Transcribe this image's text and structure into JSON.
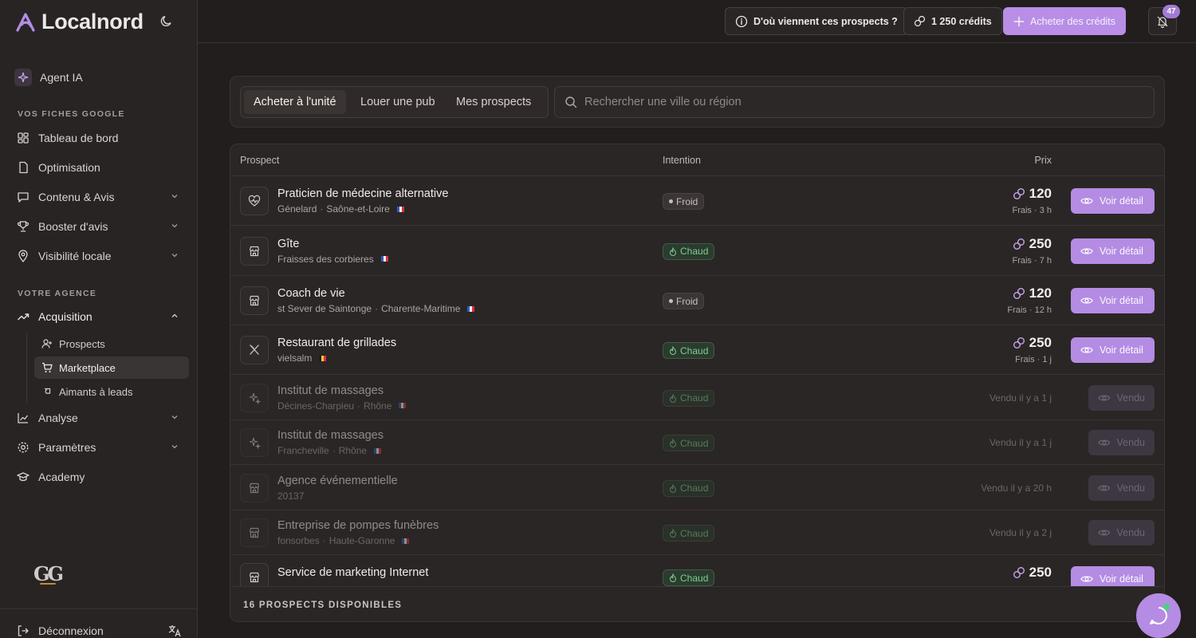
{
  "app": {
    "logo_text": "Localnord"
  },
  "header": {
    "info_label": "D'où viennent ces prospects ?",
    "credits_label": "1 250 crédits",
    "buy_label": "Acheter des crédits",
    "notification_count": "47"
  },
  "sidebar": {
    "agent_label": "Agent IA",
    "section_google": "VOS FICHES GOOGLE",
    "items_google": [
      {
        "label": "Tableau de bord",
        "icon": "dashboard-icon"
      },
      {
        "label": "Optimisation",
        "icon": "document-icon"
      },
      {
        "label": "Contenu & Avis",
        "icon": "message-icon"
      },
      {
        "label": "Booster d'avis",
        "icon": "trophy-icon"
      },
      {
        "label": "Visibilité locale",
        "icon": "map-pin-icon"
      }
    ],
    "section_agency": "VOTRE AGENCE",
    "acquisition_label": "Acquisition",
    "sub_items": [
      {
        "label": "Prospects"
      },
      {
        "label": "Marketplace"
      },
      {
        "label": "Aimants à leads"
      }
    ],
    "items_agency": [
      {
        "label": "Analyse"
      },
      {
        "label": "Paramètres"
      },
      {
        "label": "Academy"
      }
    ],
    "brand_mark": "GG",
    "logout_label": "Déconnexion"
  },
  "tabs": [
    {
      "label": "Acheter à l'unité"
    },
    {
      "label": "Louer une pub"
    },
    {
      "label": "Mes prospects"
    }
  ],
  "search": {
    "placeholder": "Rechercher une ville ou région"
  },
  "table": {
    "headers": {
      "prospect": "Prospect",
      "intention": "Intention",
      "price": "Prix"
    },
    "rows": [
      {
        "name": "Praticien de médecine alternative",
        "city": "Génelard",
        "region": "Saône-et-Loire",
        "flag": "fr",
        "intention": "Froid",
        "price": "120",
        "fee": "Frais · 3 h",
        "action": "Voir détail",
        "sold": false,
        "icon": "heart-pulse-icon"
      },
      {
        "name": "Gîte",
        "city": "Fraisses des corbieres",
        "region": "",
        "flag": "fr",
        "intention": "Chaud",
        "price": "250",
        "fee": "Frais · 7 h",
        "action": "Voir détail",
        "sold": false,
        "icon": "store-icon"
      },
      {
        "name": "Coach de vie",
        "city": "st Sever de Saintonge",
        "region": "Charente-Maritime",
        "flag": "fr",
        "intention": "Froid",
        "price": "120",
        "fee": "Frais · 12 h",
        "action": "Voir détail",
        "sold": false,
        "icon": "store-icon"
      },
      {
        "name": "Restaurant de grillades",
        "city": "vielsalm",
        "region": "",
        "flag": "be",
        "intention": "Chaud",
        "price": "250",
        "fee": "Frais · 1 j",
        "action": "Voir détail",
        "sold": false,
        "icon": "utensils-icon"
      },
      {
        "name": "Institut de massages",
        "city": "Décines-Charpieu",
        "region": "Rhône",
        "flag": "fr",
        "intention": "Chaud",
        "sold_text": "Vendu il y a 1 j",
        "action": "Vendu",
        "sold": true,
        "icon": "sparkles-icon"
      },
      {
        "name": "Institut de massages",
        "city": "Francheville",
        "region": "Rhône",
        "flag": "fr",
        "intention": "Chaud",
        "sold_text": "Vendu il y a 1 j",
        "action": "Vendu",
        "sold": true,
        "icon": "sparkles-icon"
      },
      {
        "name": "Agence événementielle",
        "city": "20137",
        "region": "",
        "flag": "",
        "intention": "Chaud",
        "sold_text": "Vendu il y a 20 h",
        "action": "Vendu",
        "sold": true,
        "icon": "store-icon"
      },
      {
        "name": "Entreprise de pompes funèbres",
        "city": "fonsorbes",
        "region": "Haute-Garonne",
        "flag": "fr",
        "intention": "Chaud",
        "sold_text": "Vendu il y a 2 j",
        "action": "Vendu",
        "sold": true,
        "icon": "store-icon"
      },
      {
        "name": "Service de marketing Internet",
        "city": "",
        "region": "",
        "flag": "",
        "intention": "Chaud",
        "price": "250",
        "action": "Voir détail",
        "sold": false,
        "partial": true,
        "icon": "store-icon"
      }
    ],
    "footer": "16 PROSPECTS DISPONIBLES"
  },
  "colors": {
    "accent": "#b48ce3",
    "background": "#211e1d",
    "panel": "#2a2625",
    "hot_text": "#7fcf8c"
  }
}
